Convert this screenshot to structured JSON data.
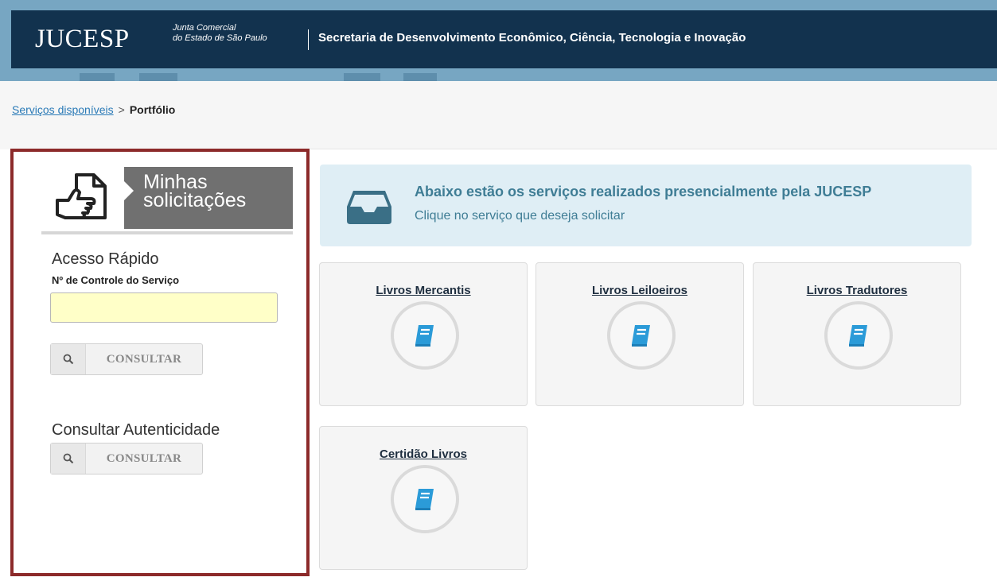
{
  "header": {
    "logo": "JUCESP",
    "logo_sub_line1": "Junta Comercial",
    "logo_sub_line2": "do Estado de São Paulo",
    "title": "Secretaria de Desenvolvimento Econômico, Ciência, Tecnologia e Inovação"
  },
  "breadcrumb": {
    "link": "Serviços disponíveis",
    "separator": ">",
    "current": "Portfólio"
  },
  "sidebar": {
    "my_requests_line1": "Minhas",
    "my_requests_line2": "solicitações",
    "quick_access_title": "Acesso Rápido",
    "control_label": "Nº de Controle do Serviço",
    "control_value": "",
    "consult_button": "CONSULTAR",
    "authenticity_title": "Consultar Autenticidade",
    "authenticity_button": "CONSULTAR"
  },
  "info": {
    "title": "Abaixo estão os serviços realizados presencialmente pela JUCESP",
    "subtitle": "Clique no serviço que deseja solicitar"
  },
  "services": [
    {
      "label": "Livros Mercantis",
      "icon": "book-icon"
    },
    {
      "label": "Livros Leiloeiros",
      "icon": "book-icon"
    },
    {
      "label": "Livros Tradutores",
      "icon": "book-icon"
    },
    {
      "label": "Certidão Livros",
      "icon": "book-icon"
    }
  ],
  "colors": {
    "header_bg": "#12324e",
    "accent_blue": "#2b9bd8",
    "panel_border": "#8c2a2a",
    "info_bg": "#dfeef5",
    "info_text": "#3f7d95"
  }
}
